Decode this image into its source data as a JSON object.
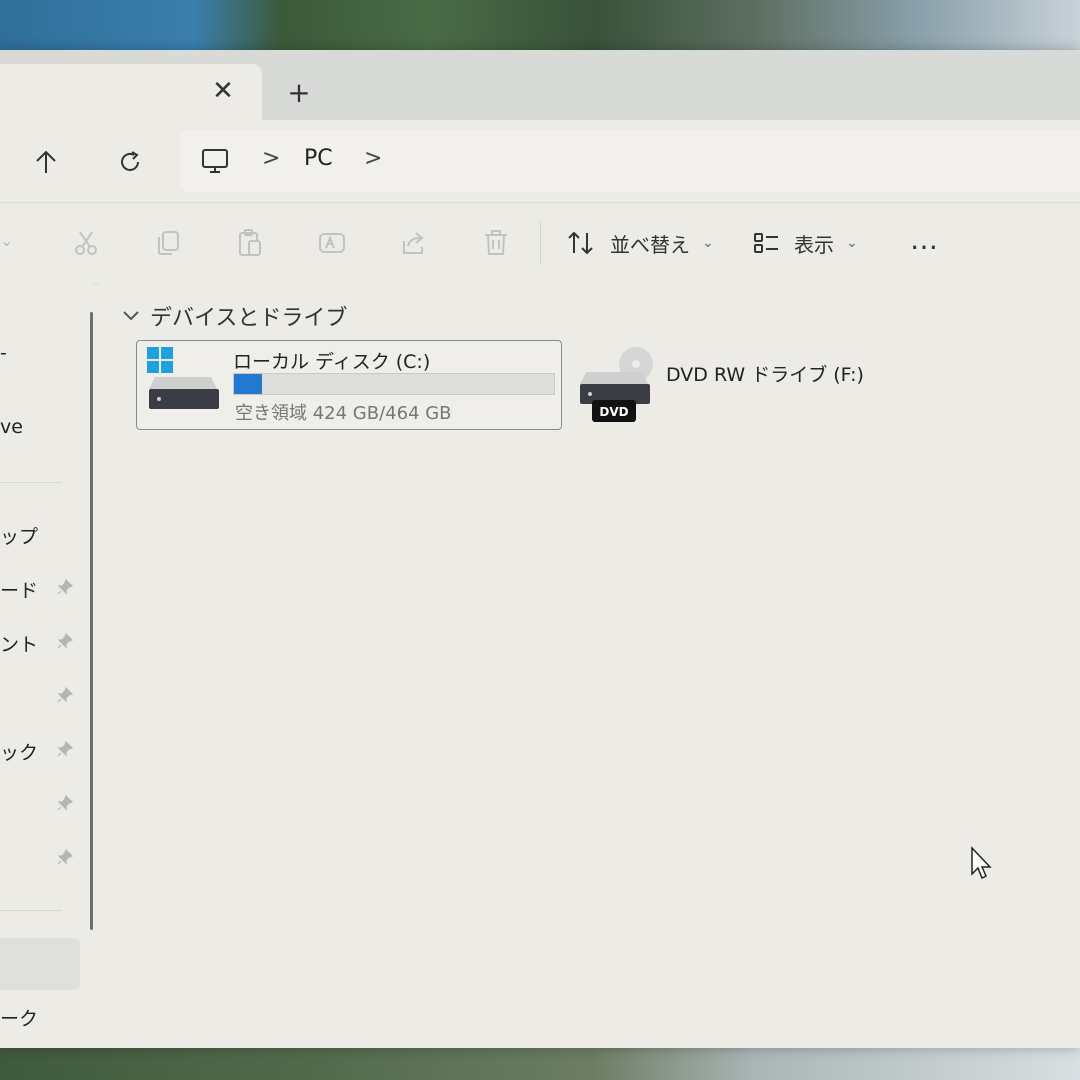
{
  "window": {
    "tab": {
      "close_glyph": "✕"
    },
    "new_tab_glyph": "+"
  },
  "address": {
    "separator": ">",
    "crumbs": [
      "PC"
    ]
  },
  "toolbar": {
    "sort_label": "並べ替え",
    "view_label": "表示",
    "more_glyph": "…",
    "icons": [
      "cut-icon",
      "copy-icon",
      "paste-icon",
      "rename-icon",
      "share-icon",
      "delete-icon"
    ]
  },
  "sidebar": {
    "items": [
      {
        "label": "ve"
      },
      {
        "label": "ップ",
        "pinned": true
      },
      {
        "label": "ード",
        "pinned": true
      },
      {
        "label": "ント",
        "pinned": true
      },
      {
        "label": "",
        "pinned": true
      },
      {
        "label": "ック",
        "pinned": true
      },
      {
        "label": "",
        "pinned": true
      },
      {
        "label": "ーク"
      }
    ]
  },
  "content": {
    "section_title": "デバイスとドライブ",
    "drives": [
      {
        "name": "ローカル ディスク (C:)",
        "free_text": "空き領域 424 GB/464 GB",
        "used_fraction": 0.086
      },
      {
        "name": "DVD RW ドライブ (F:)",
        "badge": "DVD"
      }
    ]
  },
  "colors": {
    "accent": "#2379d2",
    "windows_logo": "#1ea0e0",
    "window_bg": "#ecebe6"
  }
}
